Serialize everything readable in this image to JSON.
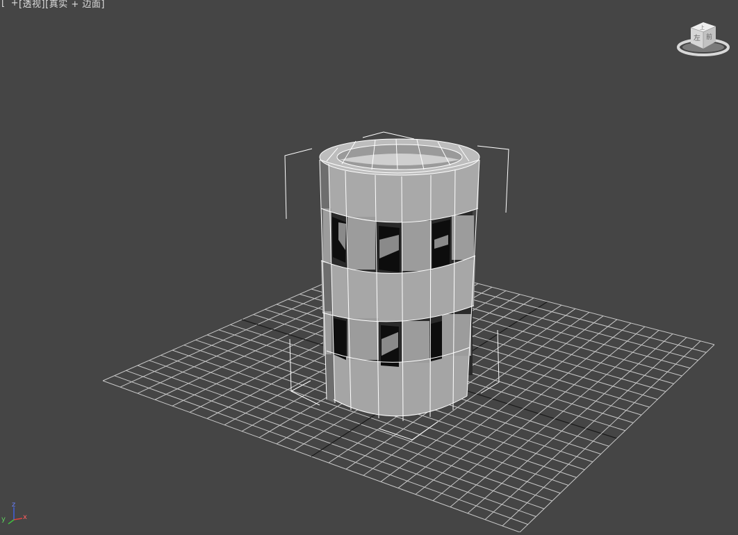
{
  "viewport": {
    "label_prefix": "[",
    "plus": "+",
    "view_name": "[透视]",
    "shading": "[真实 + 边面]",
    "label_suffix": "]"
  },
  "viewcube": {
    "face_label": "左",
    "face_label_right": "前",
    "face_label_top": "上"
  },
  "axes": {
    "x": "x",
    "y": "y",
    "z": "z"
  },
  "colors": {
    "background": "#454545",
    "grid": "#c9c9c9",
    "grid_axis": "#1a1a1a",
    "mesh_face": "#a8a8a8",
    "mesh_edge": "#ffffff",
    "bracket": "#ffffff",
    "axis_x": "#e04040",
    "axis_y": "#40c040",
    "axis_z": "#4060e0"
  }
}
